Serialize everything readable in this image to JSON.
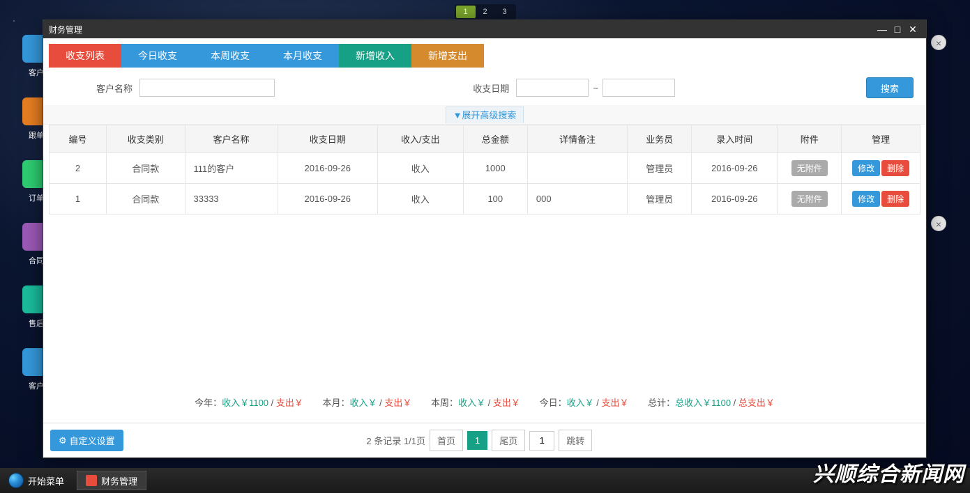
{
  "pager": [
    "1",
    "2",
    "3"
  ],
  "dock": [
    {
      "label": "客户",
      "color": "#3498db"
    },
    {
      "label": "跟单",
      "color": "#e67e22"
    },
    {
      "label": "订单",
      "color": "#2ecc71"
    },
    {
      "label": "合同",
      "color": "#9b59b6"
    },
    {
      "label": "售后",
      "color": "#1abc9c"
    },
    {
      "label": "客户",
      "color": "#3498db"
    }
  ],
  "window": {
    "title": "财务管理",
    "tabs": [
      {
        "label": "收支列表",
        "cls": "t-red"
      },
      {
        "label": "今日收支",
        "cls": "t-blue"
      },
      {
        "label": "本周收支",
        "cls": "t-blue"
      },
      {
        "label": "本月收支",
        "cls": "t-blue"
      },
      {
        "label": "新增收入",
        "cls": "t-green"
      },
      {
        "label": "新增支出",
        "cls": "t-orange"
      }
    ],
    "filter": {
      "customer_label": "客户名称",
      "date_label": "收支日期",
      "tilde": "~",
      "search": "搜索",
      "advanced": "▼展开高级搜索"
    },
    "columns": [
      "编号",
      "收支类别",
      "客户名称",
      "收支日期",
      "收入/支出",
      "总金额",
      "详情备注",
      "业务员",
      "录入时间",
      "附件",
      "管理"
    ],
    "rows": [
      {
        "id": "2",
        "cat": "合同款",
        "cust": "111的客户",
        "date": "2016-09-26",
        "io": "收入",
        "amt": "1000",
        "remark": "",
        "sales": "管理员",
        "entry": "2016-09-26",
        "att": "无附件"
      },
      {
        "id": "1",
        "cat": "合同款",
        "cust": "33333",
        "date": "2016-09-26",
        "io": "收入",
        "amt": "100",
        "remark": "000",
        "sales": "管理员",
        "entry": "2016-09-26",
        "att": "无附件"
      }
    ],
    "row_actions": {
      "edit": "修改",
      "del": "删除"
    },
    "summary": {
      "year_lbl": "今年：",
      "year_in": "收入￥1100",
      "year_out": "支出￥",
      "month_lbl": "本月：",
      "month_in": "收入￥",
      "month_out": "支出￥",
      "week_lbl": "本周：",
      "week_in": "收入￥",
      "week_out": "支出￥",
      "day_lbl": "今日：",
      "day_in": "收入￥",
      "day_out": "支出￥",
      "total_lbl": "总计：",
      "total_in": "总收入￥1100",
      "total_out": "总支出￥",
      "slash": " / "
    },
    "custom_btn": "自定义设置",
    "pagination": {
      "info": "2 条记录 1/1页",
      "first": "首页",
      "cur": "1",
      "last": "尾页",
      "goto_val": "1",
      "goto": "跳转"
    }
  },
  "taskbar": {
    "start": "开始菜单",
    "item": "财务管理"
  },
  "watermark": "兴顺综合新闻网"
}
